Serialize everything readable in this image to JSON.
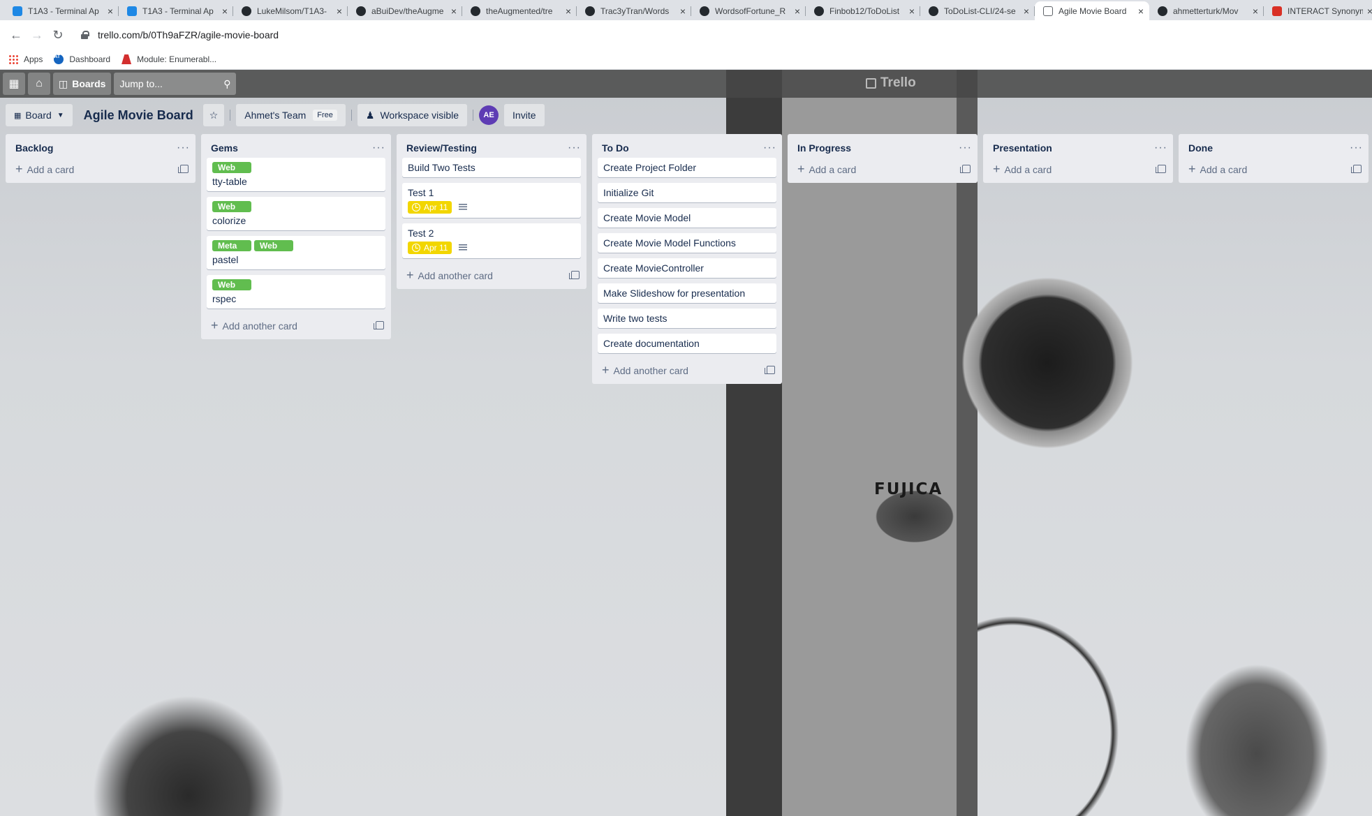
{
  "browser": {
    "tabs": [
      {
        "title": "T1A3 - Terminal Ap",
        "favicon": "ca"
      },
      {
        "title": "T1A3 - Terminal Ap",
        "favicon": "ca"
      },
      {
        "title": "LukeMilsom/T1A3-",
        "favicon": "gh"
      },
      {
        "title": "aBuiDev/theAugme",
        "favicon": "gh"
      },
      {
        "title": "theAugmented/tre",
        "favicon": "gh"
      },
      {
        "title": "Trac3yTran/Words",
        "favicon": "gh"
      },
      {
        "title": "WordsofFortune_R",
        "favicon": "gh"
      },
      {
        "title": "Finbob12/ToDoList",
        "favicon": "gh"
      },
      {
        "title": "ToDoList-CLI/24-se",
        "favicon": "gh"
      },
      {
        "title": "Agile Movie Board",
        "favicon": "tr",
        "active": true
      },
      {
        "title": "ahmetterturk/Mov",
        "favicon": "gh"
      },
      {
        "title": "INTERACT Synonym",
        "favicon": "it"
      }
    ],
    "url": "trello.com/b/0Th9aFZR/agile-movie-board",
    "bookmarks": [
      "Apps",
      "Dashboard",
      "Module: Enumerabl..."
    ]
  },
  "topnav": {
    "boards_label": "Boards",
    "search_placeholder": "Jump to...",
    "logo": "Trello"
  },
  "board": {
    "view_label": "Board",
    "title": "Agile Movie Board",
    "team": "Ahmet's Team",
    "team_badge": "Free",
    "visibility": "Workspace visible",
    "avatar_initials": "AE",
    "invite_label": "Invite"
  },
  "background_text": "FUJICA",
  "lists": [
    {
      "title": "Backlog",
      "cards": [],
      "add_label": "Add a card"
    },
    {
      "title": "Gems",
      "cards": [
        {
          "labels": [
            "Web"
          ],
          "title": "tty-table"
        },
        {
          "labels": [
            "Web"
          ],
          "title": "colorize"
        },
        {
          "labels": [
            "Meta",
            "Web"
          ],
          "title": "pastel"
        },
        {
          "labels": [
            "Web"
          ],
          "title": "rspec"
        }
      ],
      "add_label": "Add another card"
    },
    {
      "title": "Review/Testing",
      "cards": [
        {
          "labels": [],
          "title": "Build Two Tests"
        },
        {
          "labels": [],
          "title": "Test 1",
          "due": "Apr 11",
          "description": true
        },
        {
          "labels": [],
          "title": "Test 2",
          "due": "Apr 11",
          "description": true
        }
      ],
      "add_label": "Add another card"
    },
    {
      "title": "To Do",
      "cards": [
        {
          "labels": [],
          "title": "Create Project Folder"
        },
        {
          "labels": [],
          "title": "Initialize Git"
        },
        {
          "labels": [],
          "title": "Create Movie Model"
        },
        {
          "labels": [],
          "title": "Create Movie Model Functions"
        },
        {
          "labels": [],
          "title": "Create MovieController"
        },
        {
          "labels": [],
          "title": "Make Slideshow for presentation"
        },
        {
          "labels": [],
          "title": "Write two tests"
        },
        {
          "labels": [],
          "title": "Create documentation"
        }
      ],
      "add_label": "Add another card"
    },
    {
      "title": "In Progress",
      "cards": [],
      "add_label": "Add a card"
    },
    {
      "title": "Presentation",
      "cards": [],
      "add_label": "Add a card"
    },
    {
      "title": "Done",
      "cards": [],
      "add_label": "Add a card"
    }
  ]
}
